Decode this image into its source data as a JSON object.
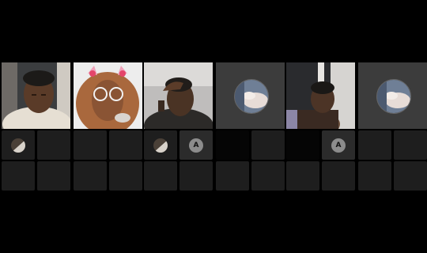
{
  "panels": [
    {
      "tiles": [
        {
          "kind": "video",
          "subject": "person-1"
        },
        {
          "kind": "video",
          "subject": "person-2-filter"
        }
      ],
      "slots_row1": [
        "thumb",
        "empty",
        "empty",
        "empty"
      ],
      "slots_row2": [
        "empty",
        "empty",
        "empty",
        "empty"
      ]
    },
    {
      "tiles": [
        {
          "kind": "video",
          "subject": "person-3"
        },
        {
          "kind": "avatar",
          "subject": "profile-photo"
        }
      ],
      "slots_row1": [
        "thumb",
        "initial",
        "dark",
        "empty"
      ],
      "slots_row2": [
        "empty",
        "empty",
        "empty",
        "empty"
      ],
      "initial": "A"
    },
    {
      "tiles": [
        {
          "kind": "video",
          "subject": "person-4"
        },
        {
          "kind": "avatar",
          "subject": "profile-photo"
        }
      ],
      "slots_row1": [
        "dark",
        "initial",
        "empty",
        "empty"
      ],
      "slots_row2": [
        "empty",
        "empty",
        "empty",
        "empty"
      ],
      "initial": "A"
    }
  ],
  "colors": {
    "background": "#000000",
    "slot": "#1e1e1e",
    "badge": "#8c8c8c"
  },
  "icons": [
    "thumbnail-icon",
    "initial-avatar-icon"
  ]
}
